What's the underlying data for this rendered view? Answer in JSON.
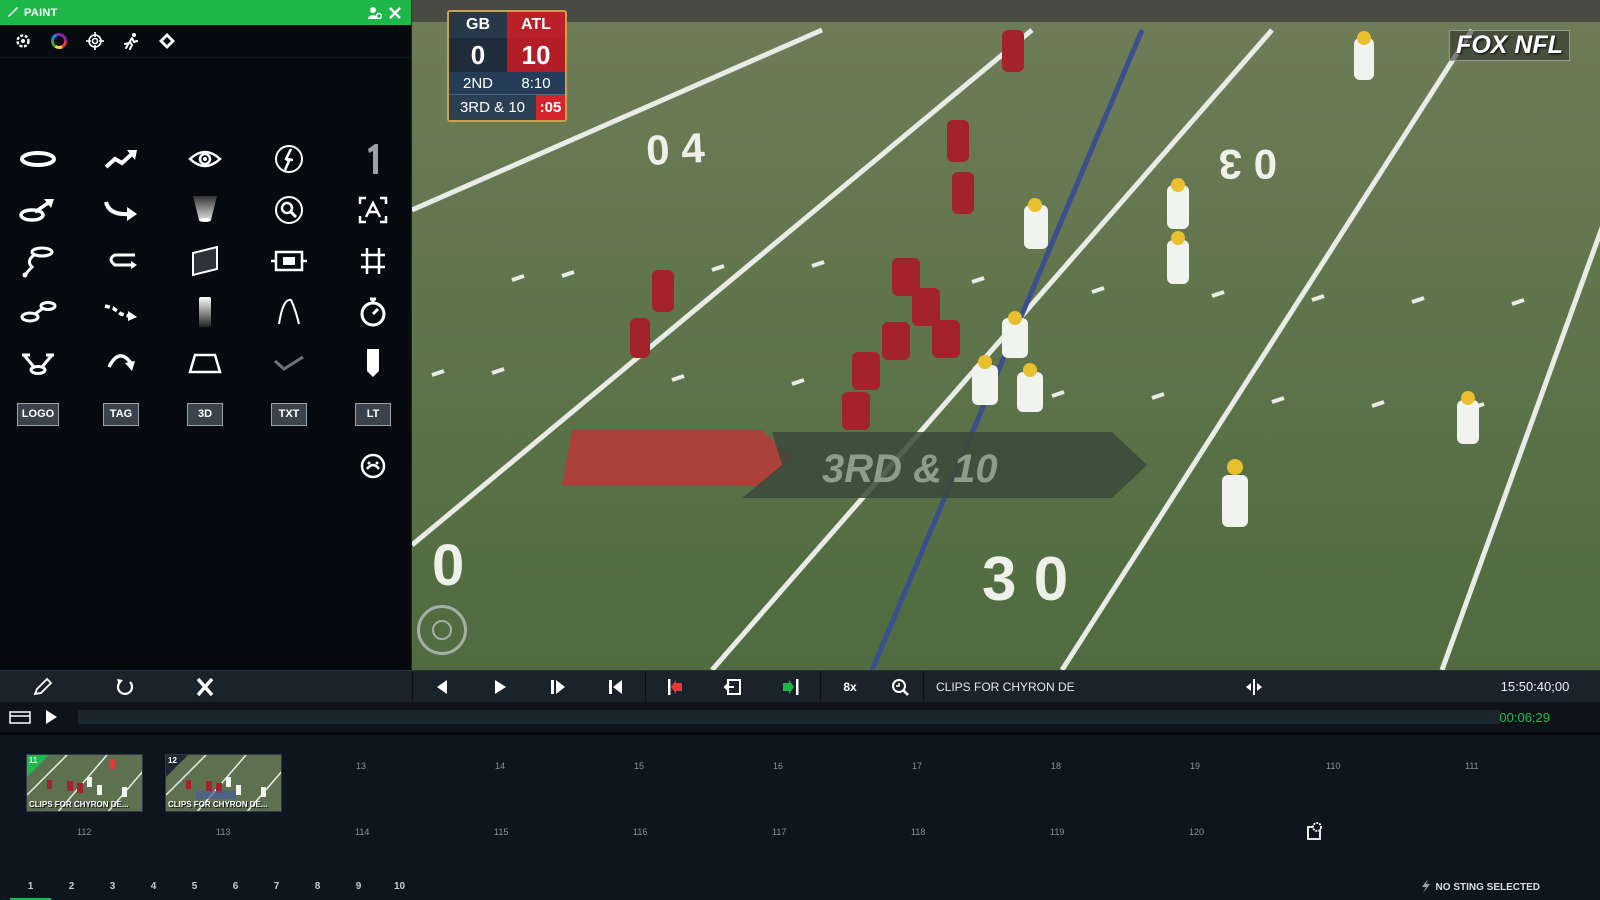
{
  "window": {
    "title": "PAINT"
  },
  "panel": {
    "toolbar_icons": [
      "settings-gear-icon",
      "color-wheel-icon",
      "target-icon",
      "runner-icon",
      "diamond-icon"
    ],
    "tools": [
      [
        "oval-marker-icon",
        "zigzag-arrow-icon",
        "eye-icon",
        "player-circle-icon",
        "number-one-icon"
      ],
      [
        "oval-arrow-icon",
        "curved-arrow-icon",
        "spotlight-cone-icon",
        "magnifier-circle-icon",
        "frame-expand-icon"
      ],
      [
        "loop-path-icon",
        "u-turn-arrow-icon",
        "panel-plane-icon",
        "camera-box-icon",
        "grid-hash-icon"
      ],
      [
        "oval-link-icon",
        "dashed-arrow-icon",
        "gradient-bar-icon",
        "arc-line-icon",
        "stopwatch-icon"
      ],
      [
        "multi-target-icon",
        "curved-return-icon",
        "trapezoid-icon",
        "check-path-icon",
        "tag-shape-icon"
      ]
    ],
    "text_buttons": {
      "logo": "LOGO",
      "tag": "TAG",
      "three_d": "3D",
      "txt": "TXT",
      "lt": "LT"
    },
    "extra_tool": "gauge-face-icon"
  },
  "scoreboard": {
    "team_away": "GB",
    "team_home": "ATL",
    "score_away": "0",
    "score_home": "10",
    "quarter": "2ND",
    "game_clock": "8:10",
    "down_distance": "3RD & 10",
    "play_clock": ":05"
  },
  "broadcast_logo": "FOX NFL",
  "field_text": {
    "yard_40": "0 4",
    "yard_30_right": "0 3",
    "yard_30_bottom": "3 0",
    "down_graphic": "3RD & 10"
  },
  "controls": {
    "speed": "8x",
    "clip_title": "CLIPS FOR CHYRON DE",
    "timecode": "15:50:40;00"
  },
  "timeline": {
    "duration": "00:06;29"
  },
  "bin": {
    "row1": [
      {
        "num": "11",
        "caption": "CLIPS FOR CHYRON DE...",
        "filled": true,
        "active": true
      },
      {
        "num": "12",
        "caption": "CLIPS FOR CHYRON DE...",
        "filled": true,
        "active": false
      },
      {
        "num": "13"
      },
      {
        "num": "14"
      },
      {
        "num": "15"
      },
      {
        "num": "16"
      },
      {
        "num": "17"
      },
      {
        "num": "18"
      },
      {
        "num": "19"
      },
      {
        "num": "110"
      },
      {
        "num": "111"
      }
    ],
    "row2": [
      "112",
      "113",
      "114",
      "115",
      "116",
      "117",
      "118",
      "119",
      "120"
    ],
    "pages": [
      "1",
      "2",
      "3",
      "4",
      "5",
      "6",
      "7",
      "8",
      "9",
      "10"
    ],
    "active_page": "1",
    "sting_status": "NO STING SELECTED"
  },
  "colors": {
    "accent": "#1db74a",
    "panel_bg": "#070b0f",
    "controls_bg": "#1a232c",
    "bin_bg": "#0d161f",
    "home_red": "#b9202a",
    "duration_green": "#1fc14b"
  }
}
